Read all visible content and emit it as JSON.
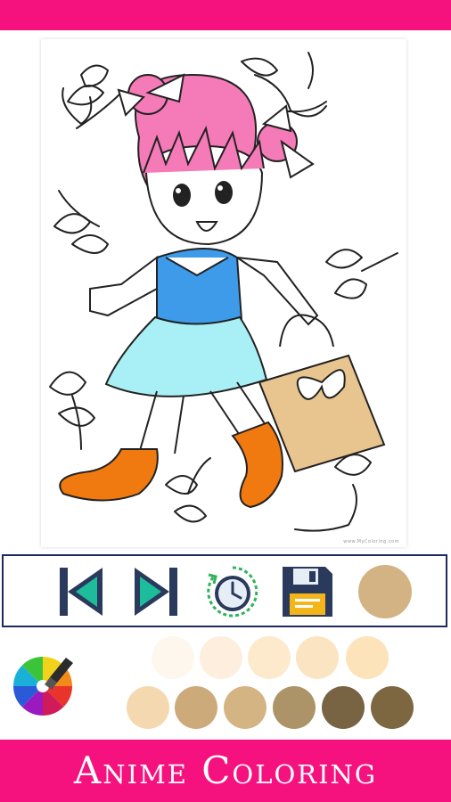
{
  "app": {
    "title": "Anime Coloring",
    "brand_color": "#f5117e",
    "toolbar_border_color": "#1e2a5a"
  },
  "canvas": {
    "credit_text": "www.MyColoring.com",
    "fill_colors": {
      "hair": "#f57ab8",
      "dress_top": "#3d9be9",
      "skirt": "#a8f0f5",
      "boots": "#f07a10",
      "bag": "#e8c48f"
    }
  },
  "toolbar": {
    "buttons": [
      {
        "name": "previous-button",
        "icon": "skip-previous-icon"
      },
      {
        "name": "next-button",
        "icon": "skip-next-icon"
      },
      {
        "name": "undo-history-button",
        "icon": "clock-history-icon"
      },
      {
        "name": "save-button",
        "icon": "floppy-disk-icon"
      }
    ],
    "current_color": "#d3b384"
  },
  "palette": {
    "row1": [
      "#fdf7ee",
      "#fdeedd",
      "#fde9cc",
      "#fbe4c1",
      "#fde3ba"
    ],
    "row2": [
      "#f4d9b0",
      "#cdaa7a",
      "#d5b483",
      "#ad9468",
      "#786342",
      "#7c6741"
    ]
  }
}
